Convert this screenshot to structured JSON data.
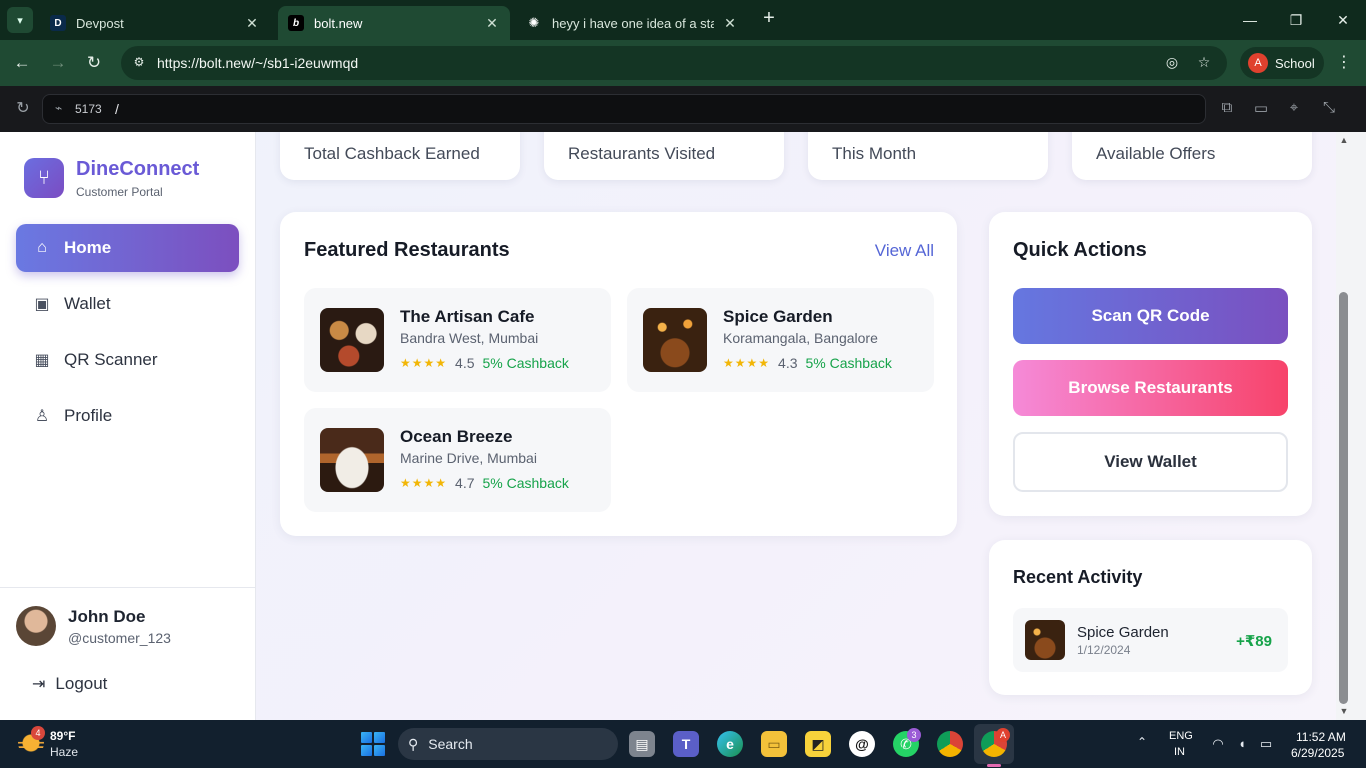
{
  "browser": {
    "tabs": [
      {
        "title": "Devpost",
        "favicon": "D",
        "active": false
      },
      {
        "title": "bolt.new",
        "favicon": "b",
        "active": true
      },
      {
        "title": "heyy i have one idea of a startu",
        "favicon": "",
        "active": false
      }
    ],
    "url": "https://bolt.new/~/sb1-i2euwmqd",
    "profile_initial": "A",
    "profile_name": "School"
  },
  "devbar": {
    "port": "5173",
    "path": "/"
  },
  "app": {
    "brand_name": "DineConnect",
    "brand_subtitle": "Customer Portal",
    "nav": [
      {
        "label": "Home",
        "active": true,
        "icon": "home-icon"
      },
      {
        "label": "Wallet",
        "active": false,
        "icon": "wallet-icon"
      },
      {
        "label": "QR Scanner",
        "active": false,
        "icon": "qr-icon"
      },
      {
        "label": "Profile",
        "active": false,
        "icon": "user-icon"
      }
    ],
    "user": {
      "name": "John Doe",
      "handle": "@customer_123"
    },
    "logout_label": "Logout",
    "stats": [
      {
        "label": "Total Cashback Earned"
      },
      {
        "label": "Restaurants Visited"
      },
      {
        "label": "This Month"
      },
      {
        "label": "Available Offers"
      }
    ],
    "featured": {
      "title": "Featured Restaurants",
      "view_all": "View All",
      "restaurants": [
        {
          "name": "The Artisan Cafe",
          "location": "Bandra West, Mumbai",
          "stars": "★★★★",
          "rating": "4.5",
          "cashback": "5% Cashback"
        },
        {
          "name": "Spice Garden",
          "location": "Koramangala, Bangalore",
          "stars": "★★★★",
          "rating": "4.3",
          "cashback": "5% Cashback"
        },
        {
          "name": "Ocean Breeze",
          "location": "Marine Drive, Mumbai",
          "stars": "★★★★",
          "rating": "4.7",
          "cashback": "5% Cashback"
        }
      ]
    },
    "quick_actions": {
      "title": "Quick Actions",
      "scan": "Scan QR Code",
      "browse": "Browse Restaurants",
      "wallet": "View Wallet"
    },
    "recent": {
      "title": "Recent Activity",
      "items": [
        {
          "name": "Spice Garden",
          "date": "1/12/2024",
          "amount": "+₹89"
        }
      ]
    }
  },
  "taskbar": {
    "weather_temp": "89°F",
    "weather_cond": "Haze",
    "weather_badge": "4",
    "search": "Search",
    "whatsapp_badge": "3",
    "chrome_badge": "A",
    "lang_line1": "ENG",
    "lang_line2": "IN",
    "time": "11:52 AM",
    "date": "6/29/2025"
  },
  "colors": {
    "brand": "#6a5ad6",
    "primary_gradient_start": "#6a79e2",
    "primary_gradient_end": "#7c4fbf",
    "pink_gradient_start": "#f58ad8",
    "pink_gradient_end": "#f7436a",
    "success": "#16a34a",
    "star": "#f2b607"
  }
}
